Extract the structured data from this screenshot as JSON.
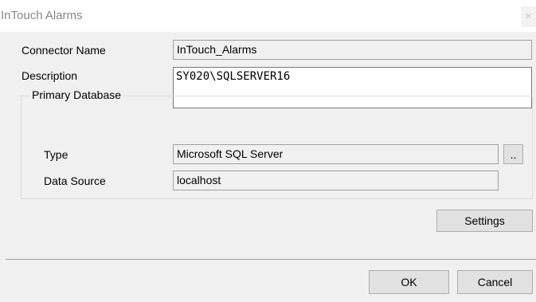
{
  "window": {
    "title": "InTouch Alarms",
    "close_glyph": "✕"
  },
  "form": {
    "connector_name_label": "Connector Name",
    "connector_name_value": "InTouch_Alarms",
    "description_label": "Description",
    "description_value": "SY020\\SQLSERVER16"
  },
  "primary_database": {
    "legend": "Primary Database",
    "type_label": "Type",
    "type_value": "Microsoft SQL Server",
    "browse_label": "..",
    "data_source_label": "Data Source",
    "data_source_value": "localhost"
  },
  "buttons": {
    "settings": "Settings",
    "ok": "OK",
    "cancel": "Cancel"
  }
}
